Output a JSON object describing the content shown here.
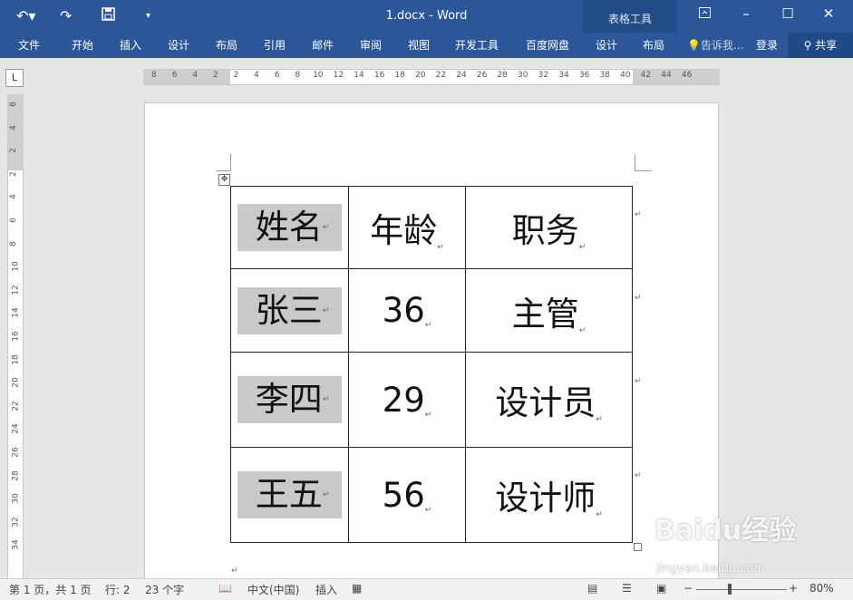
{
  "title": "1.docx - Word",
  "contextual_group": "表格工具",
  "qat": {
    "undo_icon": "undo-icon",
    "redo_icon": "redo-icon",
    "save_icon": "save-icon",
    "customize_icon": "chevron-down-icon"
  },
  "ribbon_tabs": [
    "文件",
    "开始",
    "插入",
    "设计",
    "布局",
    "引用",
    "邮件",
    "审阅",
    "视图",
    "开发工具",
    "百度网盘"
  ],
  "contextual_tabs": [
    "设计",
    "布局"
  ],
  "tell_me": "告诉我...",
  "login": "登录",
  "share": "共享",
  "window_controls": {
    "ribbon_display": "ribbon-display-icon",
    "minimize": "–",
    "maximize": "☐",
    "close": "✕"
  },
  "ruler_h_numbers": [
    "8",
    "6",
    "4",
    "2",
    "2",
    "4",
    "6",
    "8",
    "10",
    "12",
    "14",
    "16",
    "18",
    "20",
    "22",
    "24",
    "26",
    "28",
    "30",
    "32",
    "34",
    "36",
    "38",
    "40",
    "42",
    "44",
    "46"
  ],
  "ruler_v_numbers": [
    "6",
    "4",
    "2",
    "2",
    "4",
    "6",
    "8",
    "10",
    "12",
    "14",
    "16",
    "18",
    "20",
    "22",
    "24",
    "26",
    "28",
    "30",
    "32",
    "34"
  ],
  "table": {
    "rows": [
      [
        "姓名",
        "年龄",
        "职务"
      ],
      [
        "张三",
        "36",
        "主管"
      ],
      [
        "李四",
        "29",
        "设计员"
      ],
      [
        "王五",
        "56",
        "设计师"
      ]
    ],
    "highlight_color": "#c9c9c9"
  },
  "status": {
    "page": "第 1 页，共 1 页",
    "line": "行: 2",
    "words": "23 个字",
    "language": "中文(中国)",
    "mode": "插入",
    "zoom": "80%"
  },
  "watermark": {
    "brand": "Baidu经验",
    "url": "jingyan.baidu.com"
  },
  "colors": {
    "ribbon": "#2b579a",
    "contextual": "#234b86"
  }
}
